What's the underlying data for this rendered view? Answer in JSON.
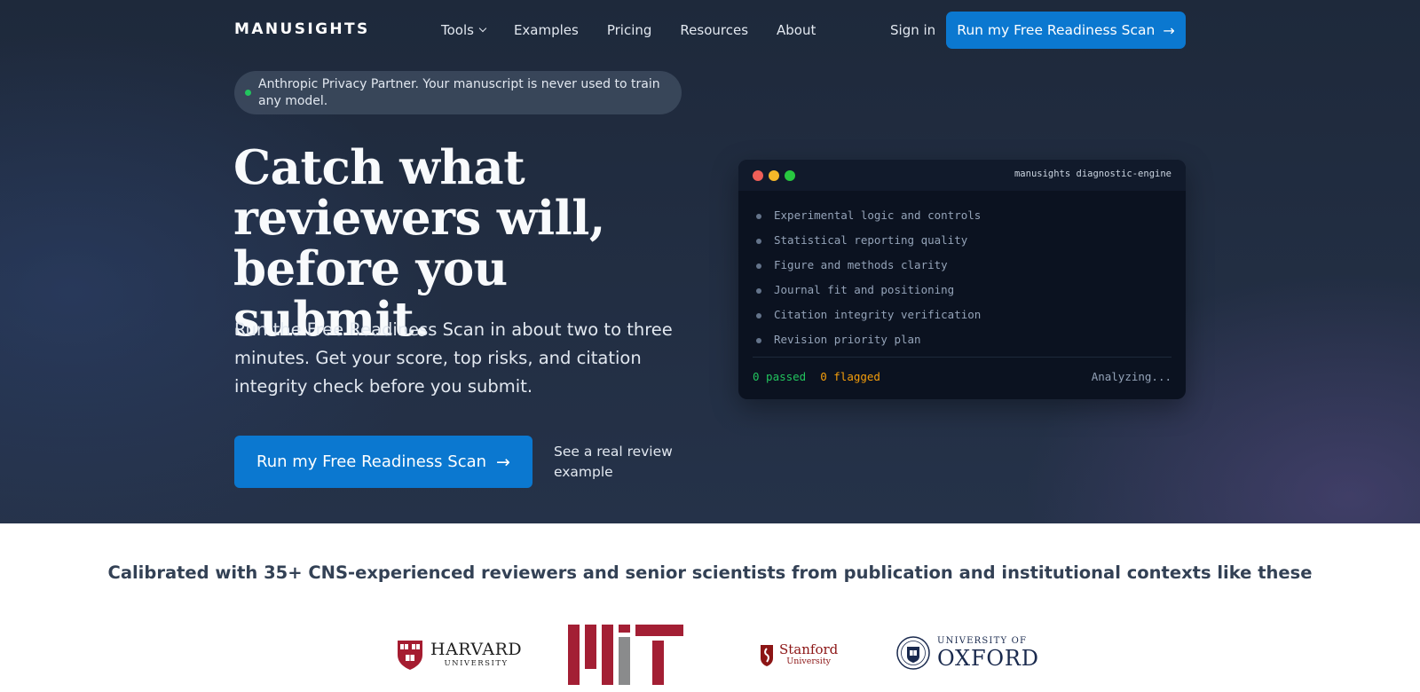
{
  "brand": {
    "name": "MANUSIGHTS"
  },
  "nav": {
    "items": [
      {
        "label": "Tools",
        "has_dropdown": true
      },
      {
        "label": "Examples"
      },
      {
        "label": "Pricing"
      },
      {
        "label": "Resources"
      },
      {
        "label": "About"
      }
    ],
    "signin_label": "Sign in",
    "cta_label": "Run my Free Readiness Scan",
    "cta_arrow": "→"
  },
  "badge": {
    "text": "Anthropic Privacy Partner. Your manuscript is never used to train any model.",
    "dot_color": "#22c55e"
  },
  "hero": {
    "headline": "Catch what reviewers will, before you submit.",
    "subheadline": "Run the Free Readiness Scan in about two to three minutes. Get your score, top risks, and citation integrity check before you submit.",
    "cta_label": "Run my Free Readiness Scan",
    "cta_arrow": "→",
    "secondary_link": "See a real review example"
  },
  "terminal": {
    "title": "manusights diagnostic-engine",
    "checks": [
      "Experimental logic and controls",
      "Statistical reporting quality",
      "Figure and methods clarity",
      "Journal fit and positioning",
      "Citation integrity verification",
      "Revision priority plan"
    ],
    "passed": "0 passed",
    "flagged": "0 flagged",
    "status": "Analyzing..."
  },
  "social_proof": {
    "heading": "Calibrated with 35+ CNS-experienced reviewers and senior scientists from publication and institutional contexts like these",
    "logos": {
      "harvard": {
        "name": "HARVARD",
        "sub": "UNIVERSITY"
      },
      "mit": {
        "name": "MIT"
      },
      "stanford": {
        "name": "Stanford",
        "sub": "University"
      },
      "oxford": {
        "top": "UNIVERSITY OF",
        "name": "OXFORD"
      }
    }
  },
  "colors": {
    "accent": "#0b78d0",
    "hero_bg": "#1e293b",
    "passed": "#22c55e",
    "flagged": "#f59e0b",
    "harvard_crimson": "#a51c30",
    "mit_red": "#a31f34",
    "stanford_cardinal": "#8c1515",
    "oxford_blue": "#1a2a4e"
  }
}
